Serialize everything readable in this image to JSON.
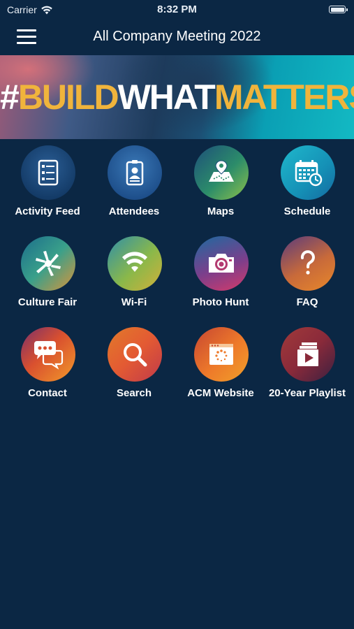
{
  "status_bar": {
    "carrier": "Carrier",
    "time": "8:32 PM",
    "battery_level": 1.0
  },
  "nav": {
    "title": "All Company Meeting 2022",
    "menu_icon": "hamburger-menu-icon"
  },
  "banner": {
    "hash": "#",
    "build": "BUILD",
    "what": "WHAT",
    "matters": "MATTERS"
  },
  "colors": {
    "background": "#0b2744",
    "banner_accent": "#f0b43c"
  },
  "tiles": [
    {
      "label": "Activity Feed",
      "icon": "activity-feed-icon"
    },
    {
      "label": "Attendees",
      "icon": "badge-icon"
    },
    {
      "label": "Maps",
      "icon": "map-icon"
    },
    {
      "label": "Schedule",
      "icon": "calendar-icon"
    },
    {
      "label": "Culture Fair",
      "icon": "hands-icon"
    },
    {
      "label": "Wi-Fi",
      "icon": "wifi-icon"
    },
    {
      "label": "Photo Hunt",
      "icon": "camera-icon"
    },
    {
      "label": "FAQ",
      "icon": "question-icon"
    },
    {
      "label": "Contact",
      "icon": "chat-icon"
    },
    {
      "label": "Search",
      "icon": "search-icon"
    },
    {
      "label": "ACM Website",
      "icon": "browser-icon"
    },
    {
      "label": "20-Year Playlist",
      "icon": "playlist-icon"
    }
  ]
}
